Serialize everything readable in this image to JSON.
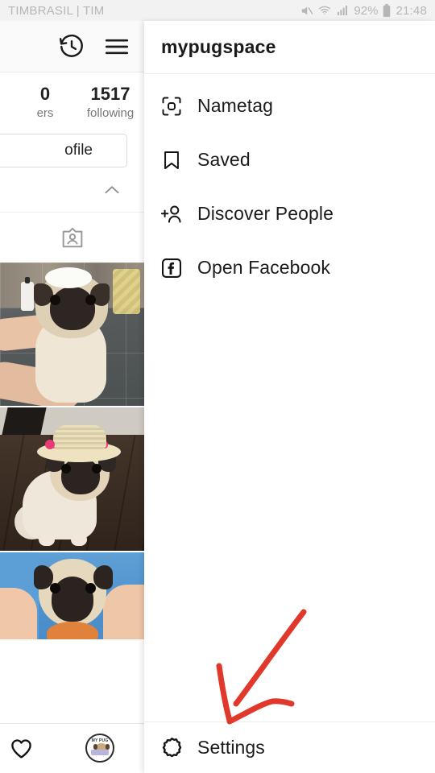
{
  "status_bar": {
    "carrier": "TIMBRASIL | TIM",
    "battery_percent": "92%",
    "clock": "21:48",
    "icons": [
      "mute-icon",
      "wifi-icon",
      "cellular-signal-icon",
      "battery-icon"
    ]
  },
  "profile_behind": {
    "header_icons": [
      "archive-history-icon",
      "hamburger-menu-icon"
    ],
    "stats": [
      {
        "number": "0",
        "label": "ers"
      },
      {
        "number": "1517",
        "label": "following"
      }
    ],
    "edit_profile_label": "ofile",
    "collapse_icon": "chevron-up-icon",
    "tagged_icon": "tagged-photos-icon",
    "photos": [
      {
        "name": "pug-bath-photo",
        "alt": "Pug being washed with shampoo in a tiled bathroom"
      },
      {
        "name": "pug-straw-hat-photo",
        "alt": "Pug wearing a straw hat with pink band on wood floor"
      },
      {
        "name": "pug-held-photo",
        "alt": "Pug held by a person wearing a blue shirt"
      }
    ],
    "bottom_nav": [
      {
        "name": "activity-heart-icon",
        "label": ""
      },
      {
        "name": "profile-avatar",
        "label": "MY PUG"
      }
    ]
  },
  "drawer": {
    "title": "mypugspace",
    "items": [
      {
        "label": "Nametag",
        "icon": "nametag-scan-icon"
      },
      {
        "label": "Saved",
        "icon": "bookmark-icon"
      },
      {
        "label": "Discover People",
        "icon": "person-add-icon"
      },
      {
        "label": "Open Facebook",
        "icon": "facebook-icon"
      }
    ],
    "footer": {
      "label": "Settings",
      "icon": "gear-icon"
    }
  },
  "annotation": {
    "type": "hand-drawn-arrow",
    "color": "#e0392c",
    "points_to": "Settings"
  },
  "colors": {
    "status_bar_bg": "#f2f2f2",
    "status_text": "#b6b6b6",
    "drawer_bg": "#ffffff",
    "text_primary": "#1c1c1c",
    "text_secondary": "#777777",
    "divider": "#ededed",
    "annotation_red": "#e0392c"
  }
}
